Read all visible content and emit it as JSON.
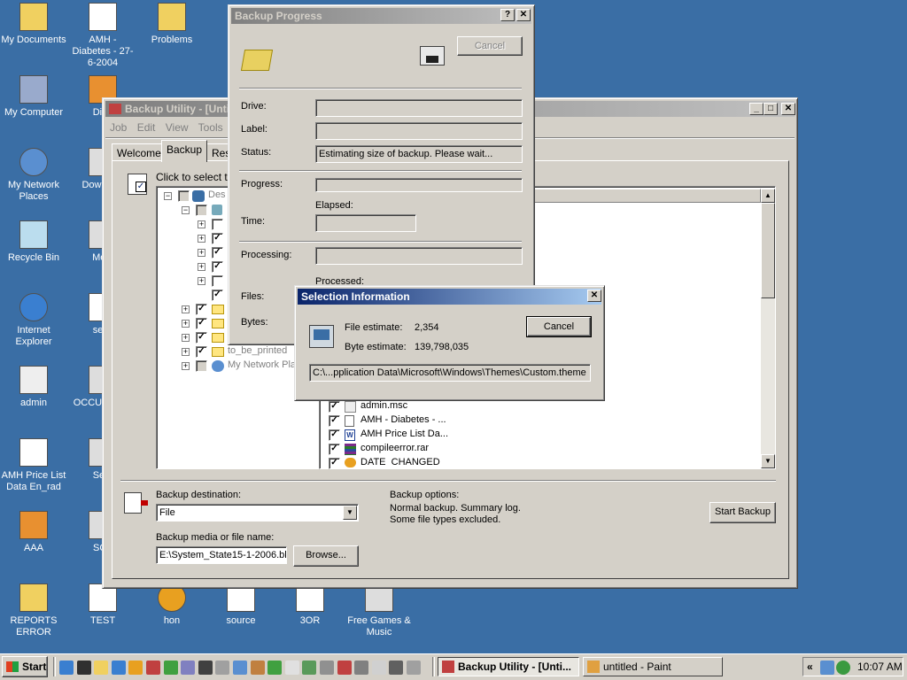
{
  "desktop": {
    "icons": [
      {
        "label": "My Documents",
        "icon": "folder-docs"
      },
      {
        "label": "AMH - Diabetes - 27-6-2004",
        "icon": "document"
      },
      {
        "label": "Problems",
        "icon": "folder"
      },
      {
        "label": "My Computer",
        "icon": "computer"
      },
      {
        "label": "Diab",
        "icon": "access-db"
      },
      {
        "label": "My Network Places",
        "icon": "network"
      },
      {
        "label": "Dow Engl",
        "icon": "shortcut"
      },
      {
        "label": "Recycle Bin",
        "icon": "recycle-bin"
      },
      {
        "label": "Medi",
        "icon": "shortcut"
      },
      {
        "label": "Internet Explorer",
        "icon": "ie"
      },
      {
        "label": "sess",
        "icon": "document"
      },
      {
        "label": "admin",
        "icon": "admin-tools"
      },
      {
        "label": "OCCU REPO",
        "icon": "shortcut"
      },
      {
        "label": "AMH Price List Data En_rad",
        "icon": "word-doc"
      },
      {
        "label": "Serv",
        "icon": "shortcut"
      },
      {
        "label": "AAA",
        "icon": "access-db"
      },
      {
        "label": "SQL",
        "icon": "shortcut"
      },
      {
        "label": "REPORTS ERROR",
        "icon": "folder"
      },
      {
        "label": "TEST",
        "icon": "document"
      },
      {
        "label": "hon",
        "icon": "sp-logo"
      },
      {
        "label": "source",
        "icon": "document"
      },
      {
        "label": "3OR",
        "icon": "document"
      },
      {
        "label": "Free Games & Music",
        "icon": "shortcut"
      }
    ]
  },
  "backup_utility": {
    "title": "Backup Utility - [Unti",
    "menu": [
      "Job",
      "Edit",
      "View",
      "Tools"
    ],
    "tabs": [
      "Welcome",
      "Backup",
      "Res"
    ],
    "instruction": "Click to select the",
    "tree": [
      "Des",
      "to_be_printed",
      "My Network Pla"
    ],
    "files": [
      "admin.msc",
      "AMH - Diabetes - ...",
      "AMH Price List Da...",
      "compileerror.rar",
      "DATE_CHANGED"
    ],
    "backup_destination_label": "Backup destination:",
    "backup_destination_value": "File",
    "media_label": "Backup media or file name:",
    "media_value": "E:\\System_State15-1-2006.bk",
    "browse_label": "Browse...",
    "options_label": "Backup options:",
    "options_line1": "Normal backup.  Summary log.",
    "options_line2": "Some file types excluded.",
    "start_label": "Start Backup"
  },
  "backup_progress": {
    "title": "Backup Progress",
    "cancel_label": "Cancel",
    "drive_label": "Drive:",
    "label_label": "Label:",
    "status_label": "Status:",
    "status_value": "Estimating size of backup. Please wait...",
    "progress_label": "Progress:",
    "elapsed_label": "Elapsed:",
    "time_label": "Time:",
    "processing_label": "Processing:",
    "processed_label": "Processed:",
    "files_label": "Files:",
    "bytes_label": "Bytes:"
  },
  "selection_info": {
    "title": "Selection Information",
    "file_estimate_label": "File estimate:",
    "file_estimate_value": "2,354",
    "byte_estimate_label": "Byte estimate:",
    "byte_estimate_value": "139,798,035",
    "cancel_label": "Cancel",
    "path": "C:\\...pplication Data\\Microsoft\\Windows\\Themes\\Custom.theme"
  },
  "taskbar": {
    "start_label": "Start",
    "tasks": [
      "Backup Utility - [Unti...",
      "untitled - Paint"
    ],
    "tray_chevron": "«",
    "clock": "10:07 AM"
  },
  "colors": {
    "desktop": "#3a6ea5",
    "title_active": "#0a246a",
    "face": "#d4d0c8"
  }
}
